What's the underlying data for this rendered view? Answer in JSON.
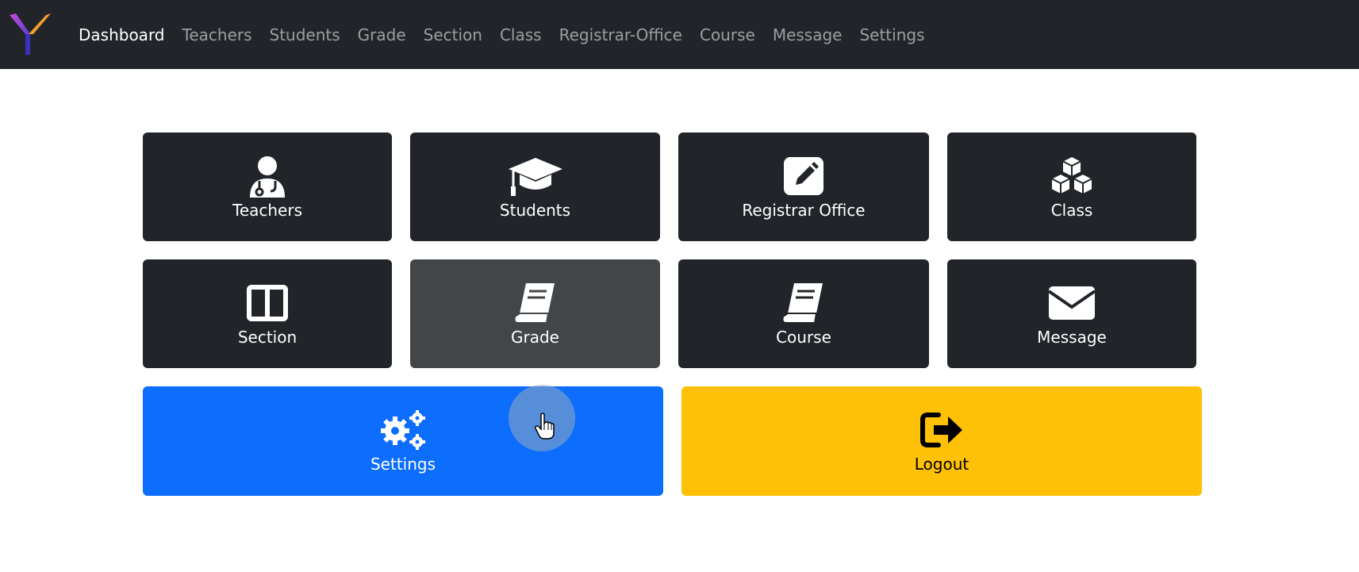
{
  "nav": {
    "logo": "Y",
    "links": [
      "Dashboard",
      "Teachers",
      "Students",
      "Grade",
      "Section",
      "Class",
      "Registrar-Office",
      "Course",
      "Message",
      "Settings"
    ],
    "active": "Dashboard"
  },
  "tiles": {
    "teachers": {
      "label": "Teachers",
      "icon": "user-doctor-icon"
    },
    "students": {
      "label": "Students",
      "icon": "graduation-cap-icon"
    },
    "registrar": {
      "label": "Registrar Office",
      "icon": "pen-to-square-icon"
    },
    "class": {
      "label": "Class",
      "icon": "cubes-icon"
    },
    "section": {
      "label": "Section",
      "icon": "columns-icon"
    },
    "grade": {
      "label": "Grade",
      "icon": "book-icon"
    },
    "course": {
      "label": "Course",
      "icon": "book-icon"
    },
    "message": {
      "label": "Message",
      "icon": "envelope-icon"
    },
    "settings": {
      "label": "Settings",
      "icon": "gears-icon"
    },
    "logout": {
      "label": "Logout",
      "icon": "sign-out-icon"
    }
  },
  "colors": {
    "navbar": "#212529",
    "tile_dark": "#212529",
    "tile_hover": "#424649",
    "primary": "#0d6efd",
    "warning": "#ffc107"
  }
}
